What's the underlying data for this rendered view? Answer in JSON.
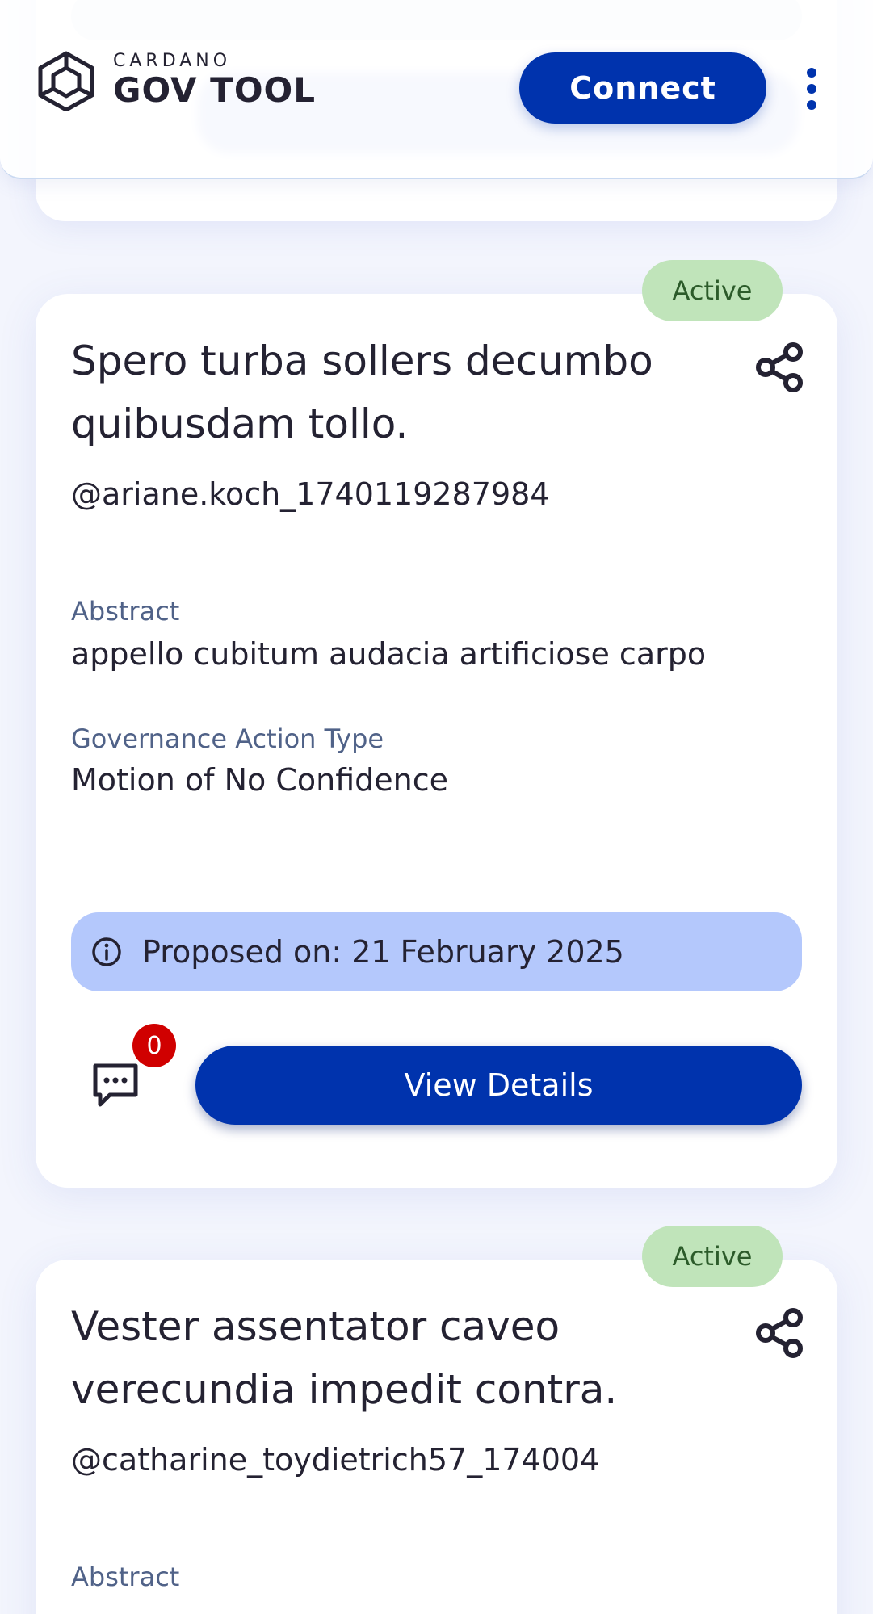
{
  "header": {
    "logo_small": "CARDANO",
    "logo_big": "GOV TOOL",
    "connect_label": "Connect"
  },
  "proposals": [
    {
      "status": "Active",
      "title": "Spero turba sollers decumbo quibusdam tollo.",
      "author": "@ariane.koch_1740119287984",
      "abstract_label": "Abstract",
      "abstract": "appello cubitum audacia artificiose carpo",
      "type_label": "Governance Action Type",
      "type": "Motion of No Confidence",
      "proposed_on": "Proposed on: 21 February 2025",
      "comment_count": "0",
      "view_label": "View Details"
    },
    {
      "status": "Active",
      "title": "Vester assentator caveo verecundia impedit contra.",
      "author": "@catharine_toydietrich57_174004",
      "abstract_label": "Abstract"
    }
  ],
  "colors": {
    "primary": "#0033ad",
    "badge_bg": "#c0e4ba",
    "badge_text": "#2c5b2a",
    "info_bar": "#b4c8fc",
    "label": "#506288",
    "count_badge": "#d00000"
  },
  "icons": {
    "logo": "cardano-hex-logo-icon",
    "menu": "vertical-dots-icon",
    "share": "share-icon",
    "info": "info-icon",
    "comment": "comment-icon"
  }
}
